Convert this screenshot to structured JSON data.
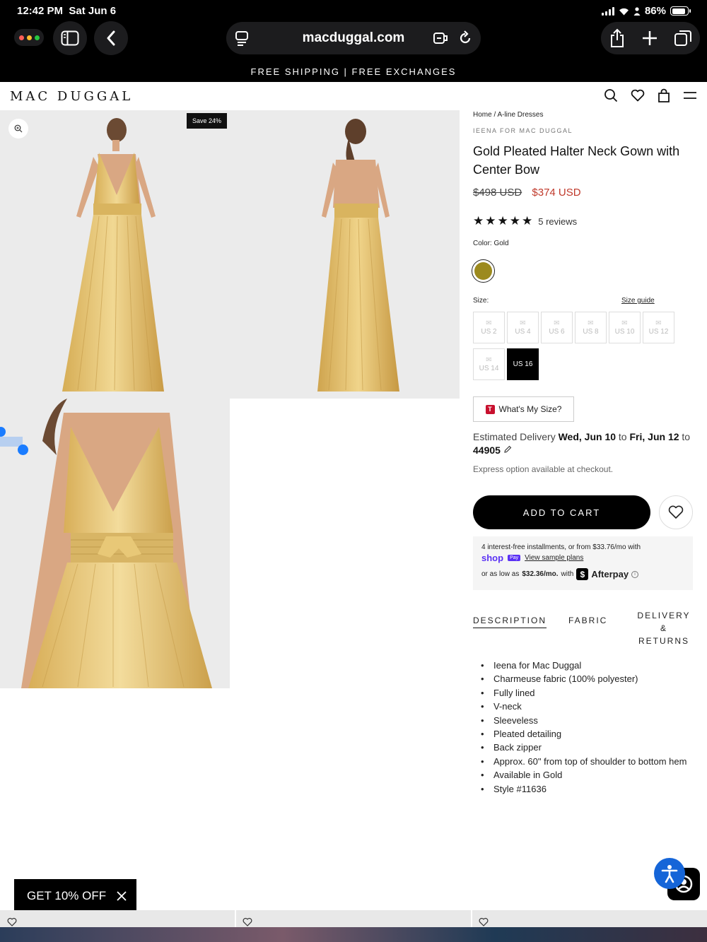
{
  "status": {
    "time": "12:42 PM",
    "date": "Sat Jun 6",
    "battery": "86%"
  },
  "browser": {
    "url": "macduggal.com"
  },
  "promo": {
    "text": "FREE SHIPPING | FREE EXCHANGES"
  },
  "site": {
    "logo": "MAC DUGGAL"
  },
  "gallery": {
    "badge": "Save 24%"
  },
  "product": {
    "breadcrumb": "Home / A-line Dresses",
    "brand": "IEENA FOR MAC DUGGAL",
    "title": "Gold Pleated Halter Neck Gown with Center Bow",
    "price_original": "$498 USD",
    "price_sale": "$374 USD",
    "rating_stars": 5,
    "reviews": "5 reviews",
    "color_label": "Color: Gold",
    "swatch_color": "#9c8a1e",
    "size_label": "Size:",
    "size_guide": "Size guide",
    "sizes": [
      "US 2",
      "US 4",
      "US 6",
      "US 8",
      "US 10",
      "US 12",
      "US 14",
      "US 16"
    ],
    "selected_size": "US 16",
    "whats_my_size": "What's My Size?",
    "delivery_prefix": "Estimated Delivery",
    "delivery_from": "Wed, Jun 10",
    "delivery_to_word": "to",
    "delivery_to": "Fri, Jun 12",
    "delivery_zip_prefix": "to",
    "delivery_zip": "44905",
    "express": "Express option available at checkout.",
    "add_to_cart": "ADD TO CART"
  },
  "payment": {
    "installments": "4 interest-free installments, or from $33.76/mo with",
    "shop_logo": "shop",
    "shop_pay": "Pay",
    "sample_plans": "View sample plans",
    "afterpay_prefix": "or as low as",
    "afterpay_amount": "$32.36/mo.",
    "afterpay_with": "with",
    "afterpay_brand": "Afterpay"
  },
  "tabs": {
    "description": "DESCRIPTION",
    "fabric": "FABRIC",
    "delivery": "DELIVERY & RETURNS"
  },
  "description": [
    "Ieena for Mac Duggal",
    "Charmeuse fabric (100% polyester)",
    "Fully lined",
    "V-neck",
    "Sleeveless",
    "Pleated detailing",
    "Back zipper",
    "Approx. 60\" from top of shoulder to bottom hem",
    "Available in Gold",
    "Style #11636"
  ],
  "discount": {
    "label": "GET 10% OFF"
  },
  "colors": {
    "accent_sale": "#c0392b",
    "gown_gold": "#e2c272",
    "shop_purple": "#5a31f4",
    "access_blue": "#1565d8"
  }
}
